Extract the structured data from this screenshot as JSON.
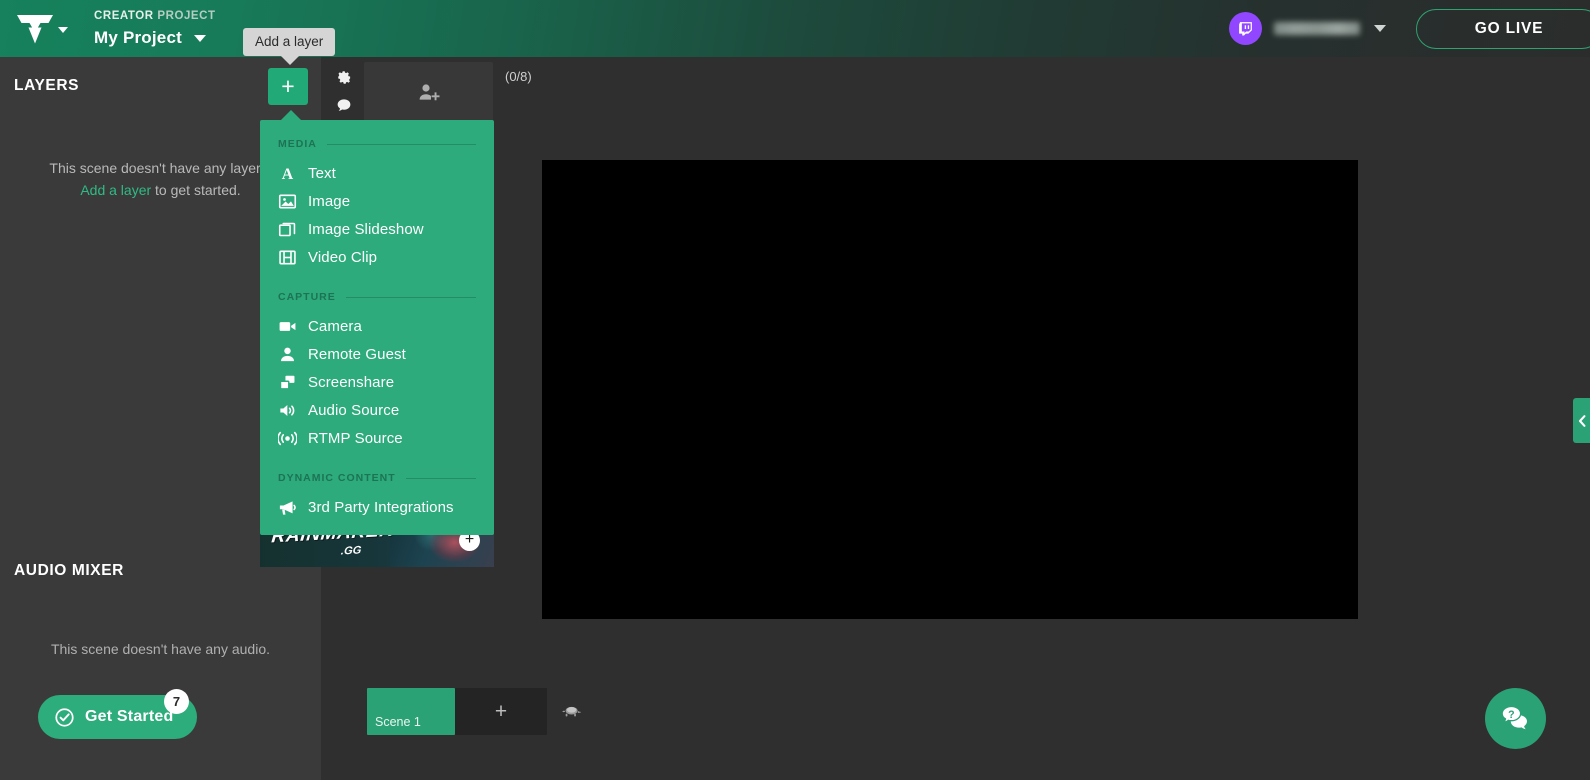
{
  "header": {
    "logo_name": "lightstream-logo",
    "project_kicker_strong": "CREATOR",
    "project_kicker_rest": " PROJECT",
    "project_name": "My Project",
    "account_platform_icon": "twitch-icon",
    "account_name": "",
    "go_live_label": "GO LIVE",
    "accent_color": "#2dab7c",
    "twitch_color": "#9147ff"
  },
  "tooltip": {
    "text": "Add a layer"
  },
  "toolbar": {
    "add_layer_icon": "plus-icon",
    "settings_icon": "gear-icon",
    "chat_icon": "chat-bubble-icon",
    "invite_guest_icon": "add-person-icon",
    "guest_count": "(0/8)"
  },
  "sidebar": {
    "layers_title": "LAYERS",
    "layers_empty_line1": "This scene doesn't have any layers.",
    "layers_empty_link": "Add a layer",
    "layers_empty_line2": " to get started.",
    "mixer_title": "AUDIO MIXER",
    "mixer_empty": "This scene doesn't have any audio.",
    "get_started_label": "Get Started",
    "get_started_badge": "7",
    "get_started_icon": "check-circle-icon"
  },
  "layer_menu": {
    "sections": [
      {
        "label": "MEDIA",
        "items": [
          {
            "label": "Text",
            "icon": "text-a-icon"
          },
          {
            "label": "Image",
            "icon": "image-icon"
          },
          {
            "label": "Image Slideshow",
            "icon": "slideshow-icon"
          },
          {
            "label": "Video Clip",
            "icon": "film-icon"
          }
        ]
      },
      {
        "label": "CAPTURE",
        "items": [
          {
            "label": "Camera",
            "icon": "video-camera-icon"
          },
          {
            "label": "Remote Guest",
            "icon": "person-icon"
          },
          {
            "label": "Screenshare",
            "icon": "screenshare-icon"
          },
          {
            "label": "Audio Source",
            "icon": "speaker-icon"
          },
          {
            "label": "RTMP Source",
            "icon": "broadcast-icon"
          }
        ]
      },
      {
        "label": "DYNAMIC CONTENT",
        "items": [
          {
            "label": "3rd Party Integrations",
            "icon": "megaphone-icon"
          }
        ]
      }
    ]
  },
  "promo": {
    "word": "RAINMAKER",
    "tld": ".GG",
    "add_icon": "plus-circle-icon"
  },
  "scene_bar": {
    "scene_label": "Scene 1",
    "add_scene_icon": "plus-icon",
    "transition_icon": "transition-turtle-icon"
  },
  "right_panel": {
    "collapse_icon": "chevron-left-icon"
  },
  "help": {
    "icon": "help-chat-icon"
  }
}
